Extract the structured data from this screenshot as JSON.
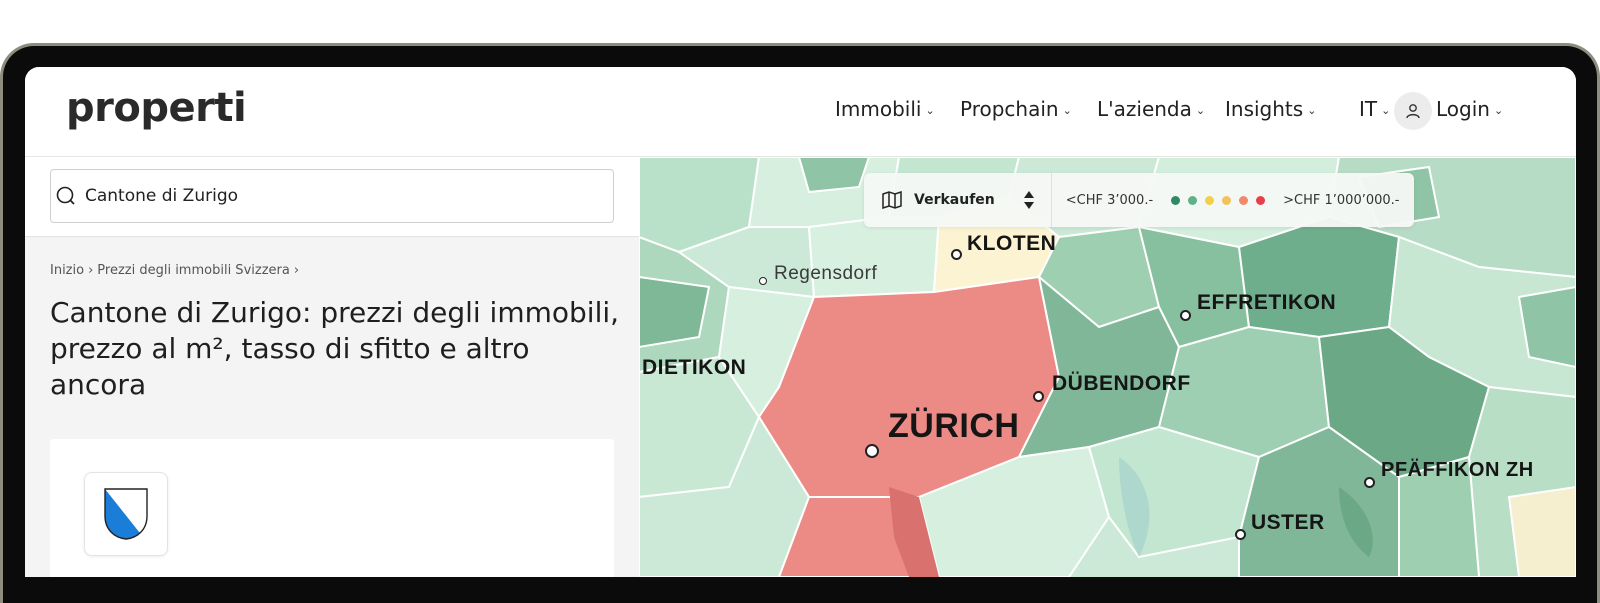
{
  "brand": {
    "logo": "properti"
  },
  "nav": {
    "items": [
      {
        "label": "Immobili"
      },
      {
        "label": "Propchain"
      },
      {
        "label": "L'azienda"
      },
      {
        "label": "Insights"
      }
    ],
    "language": "IT",
    "login": "Login"
  },
  "search": {
    "value": "Cantone di Zurigo"
  },
  "breadcrumb": {
    "home": "Inizio",
    "level1": "Prezzi degli immobili Svizzera",
    "sep": "›"
  },
  "page": {
    "title": "Cantone di Zurigo: prezzi degli immobili, prezzo al m², tasso di sfitto e altro ancora"
  },
  "map": {
    "mode_label": "Verkaufen",
    "legend_min": "<CHF 3’000.-",
    "legend_max": ">CHF 1’000’000.-",
    "legend_colors": [
      "#2e8a63",
      "#5cb38a",
      "#f3cf4a",
      "#f2c35a",
      "#f08a6a",
      "#e8404a"
    ],
    "cities": {
      "kloten": "KLOTEN",
      "regensdorf": "Regensdorf",
      "effretikon": "EFFRETIKON",
      "dietikon": "DIETIKON",
      "dubendorf": "DÜBENDORF",
      "zurich": "ZÜRICH",
      "pfaffikon": "PFÄFFIKON ZH",
      "uster": "USTER"
    }
  }
}
